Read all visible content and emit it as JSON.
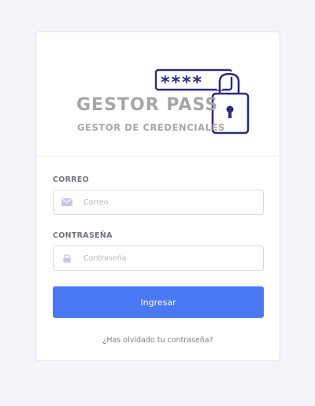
{
  "logo": {
    "title": "GESTOR PASS",
    "subtitle": "GESTOR DE CREDENCIALES",
    "password_mask": "****",
    "accent_color": "#2b2d7c"
  },
  "form": {
    "email": {
      "label": "CORREO",
      "placeholder": "Correo",
      "value": "",
      "icon": "envelope-icon"
    },
    "password": {
      "label": "CONTRASEÑA",
      "placeholder": "Contraseña",
      "value": "",
      "icon": "lock-icon"
    },
    "submit_label": "Ingresar",
    "forgot_label": "¿Has olvidado tu contraseña?"
  },
  "colors": {
    "button": "#4a78f5",
    "background": "#f4f5fa",
    "icon_tint": "#c7c9e6"
  }
}
